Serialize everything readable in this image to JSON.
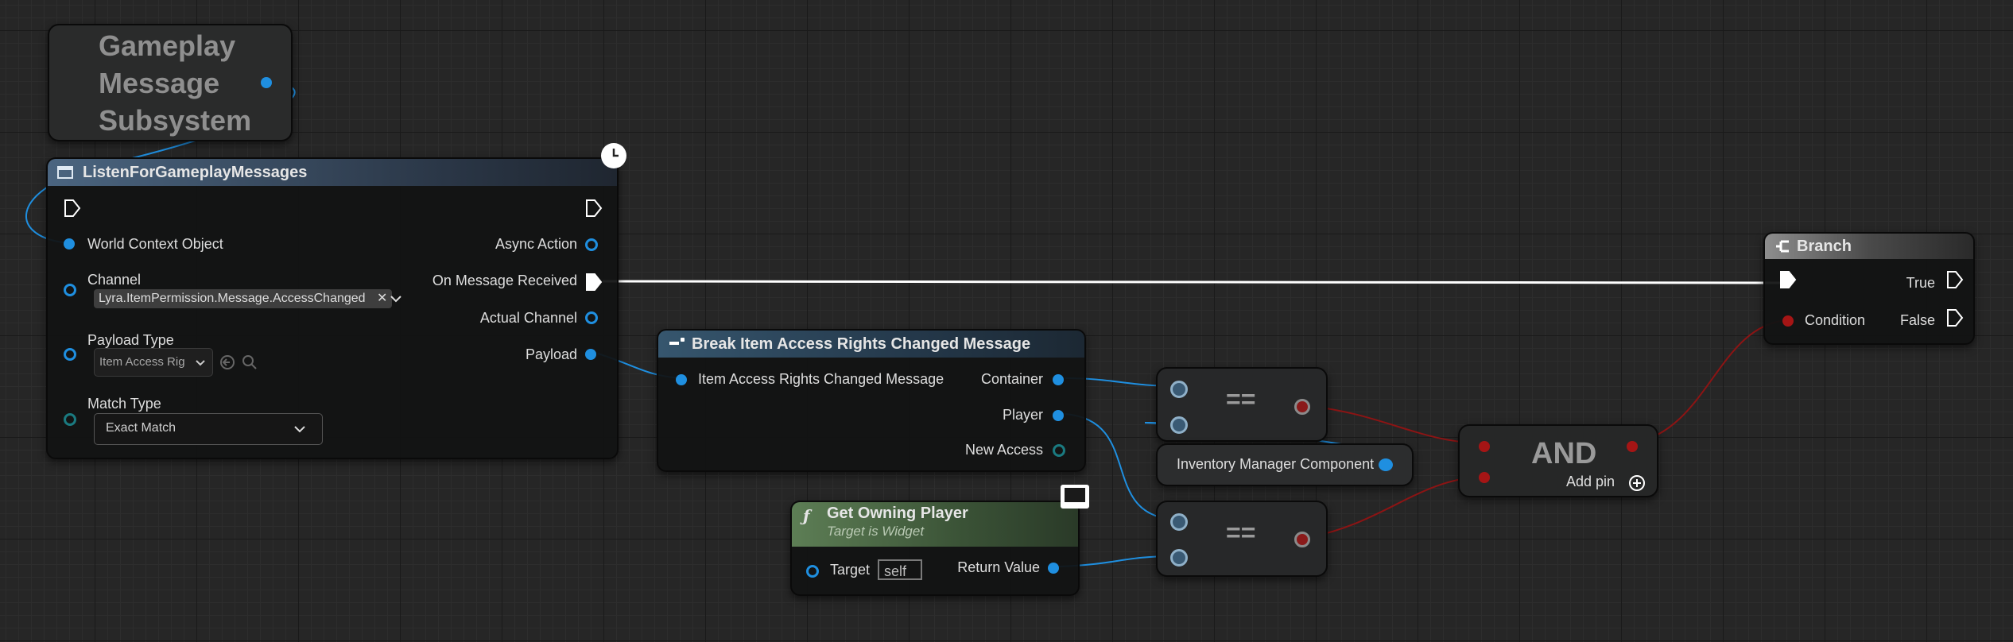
{
  "subsystem_node": {
    "title": "Gameplay Message Subsystem",
    "lines": [
      "Gameplay",
      "Message",
      "Subsystem"
    ]
  },
  "listen_node": {
    "title": "ListenForGameplayMessages",
    "world_context": "World Context Object",
    "channel_label": "Channel",
    "channel_value": "Lyra.ItemPermission.Message.AccessChanged",
    "payload_type_label": "Payload Type",
    "payload_type_value": "Item Access Rig",
    "match_type_label": "Match Type",
    "match_type_value": "Exact Match",
    "async_action": "Async Action",
    "on_message_received": "On Message Received",
    "actual_channel": "Actual Channel",
    "payload": "Payload"
  },
  "break_node": {
    "title": "Break Item Access Rights Changed Message",
    "input": "Item Access Rights Changed Message",
    "container": "Container",
    "player": "Player",
    "new_access": "New Access"
  },
  "owning_player_node": {
    "title": "Get Owning Player",
    "subtitle": "Target is Widget",
    "target": "Target",
    "target_default": "self",
    "return_value": "Return Value"
  },
  "equal_node_1": {
    "op": "=="
  },
  "equal_node_2": {
    "op": "=="
  },
  "inventory_node": {
    "label": "Inventory Manager Component"
  },
  "and_node": {
    "title": "AND",
    "add_pin": "Add pin"
  },
  "branch_node": {
    "title": "Branch",
    "condition": "Condition",
    "true_label": "True",
    "false_label": "False"
  },
  "colors": {
    "object_pin": "#1f8fe0",
    "bool_pin": "#a51515",
    "exec_wire": "#ffffff",
    "pure_header": "#4e6b47",
    "async_header": "#3a4d62"
  }
}
